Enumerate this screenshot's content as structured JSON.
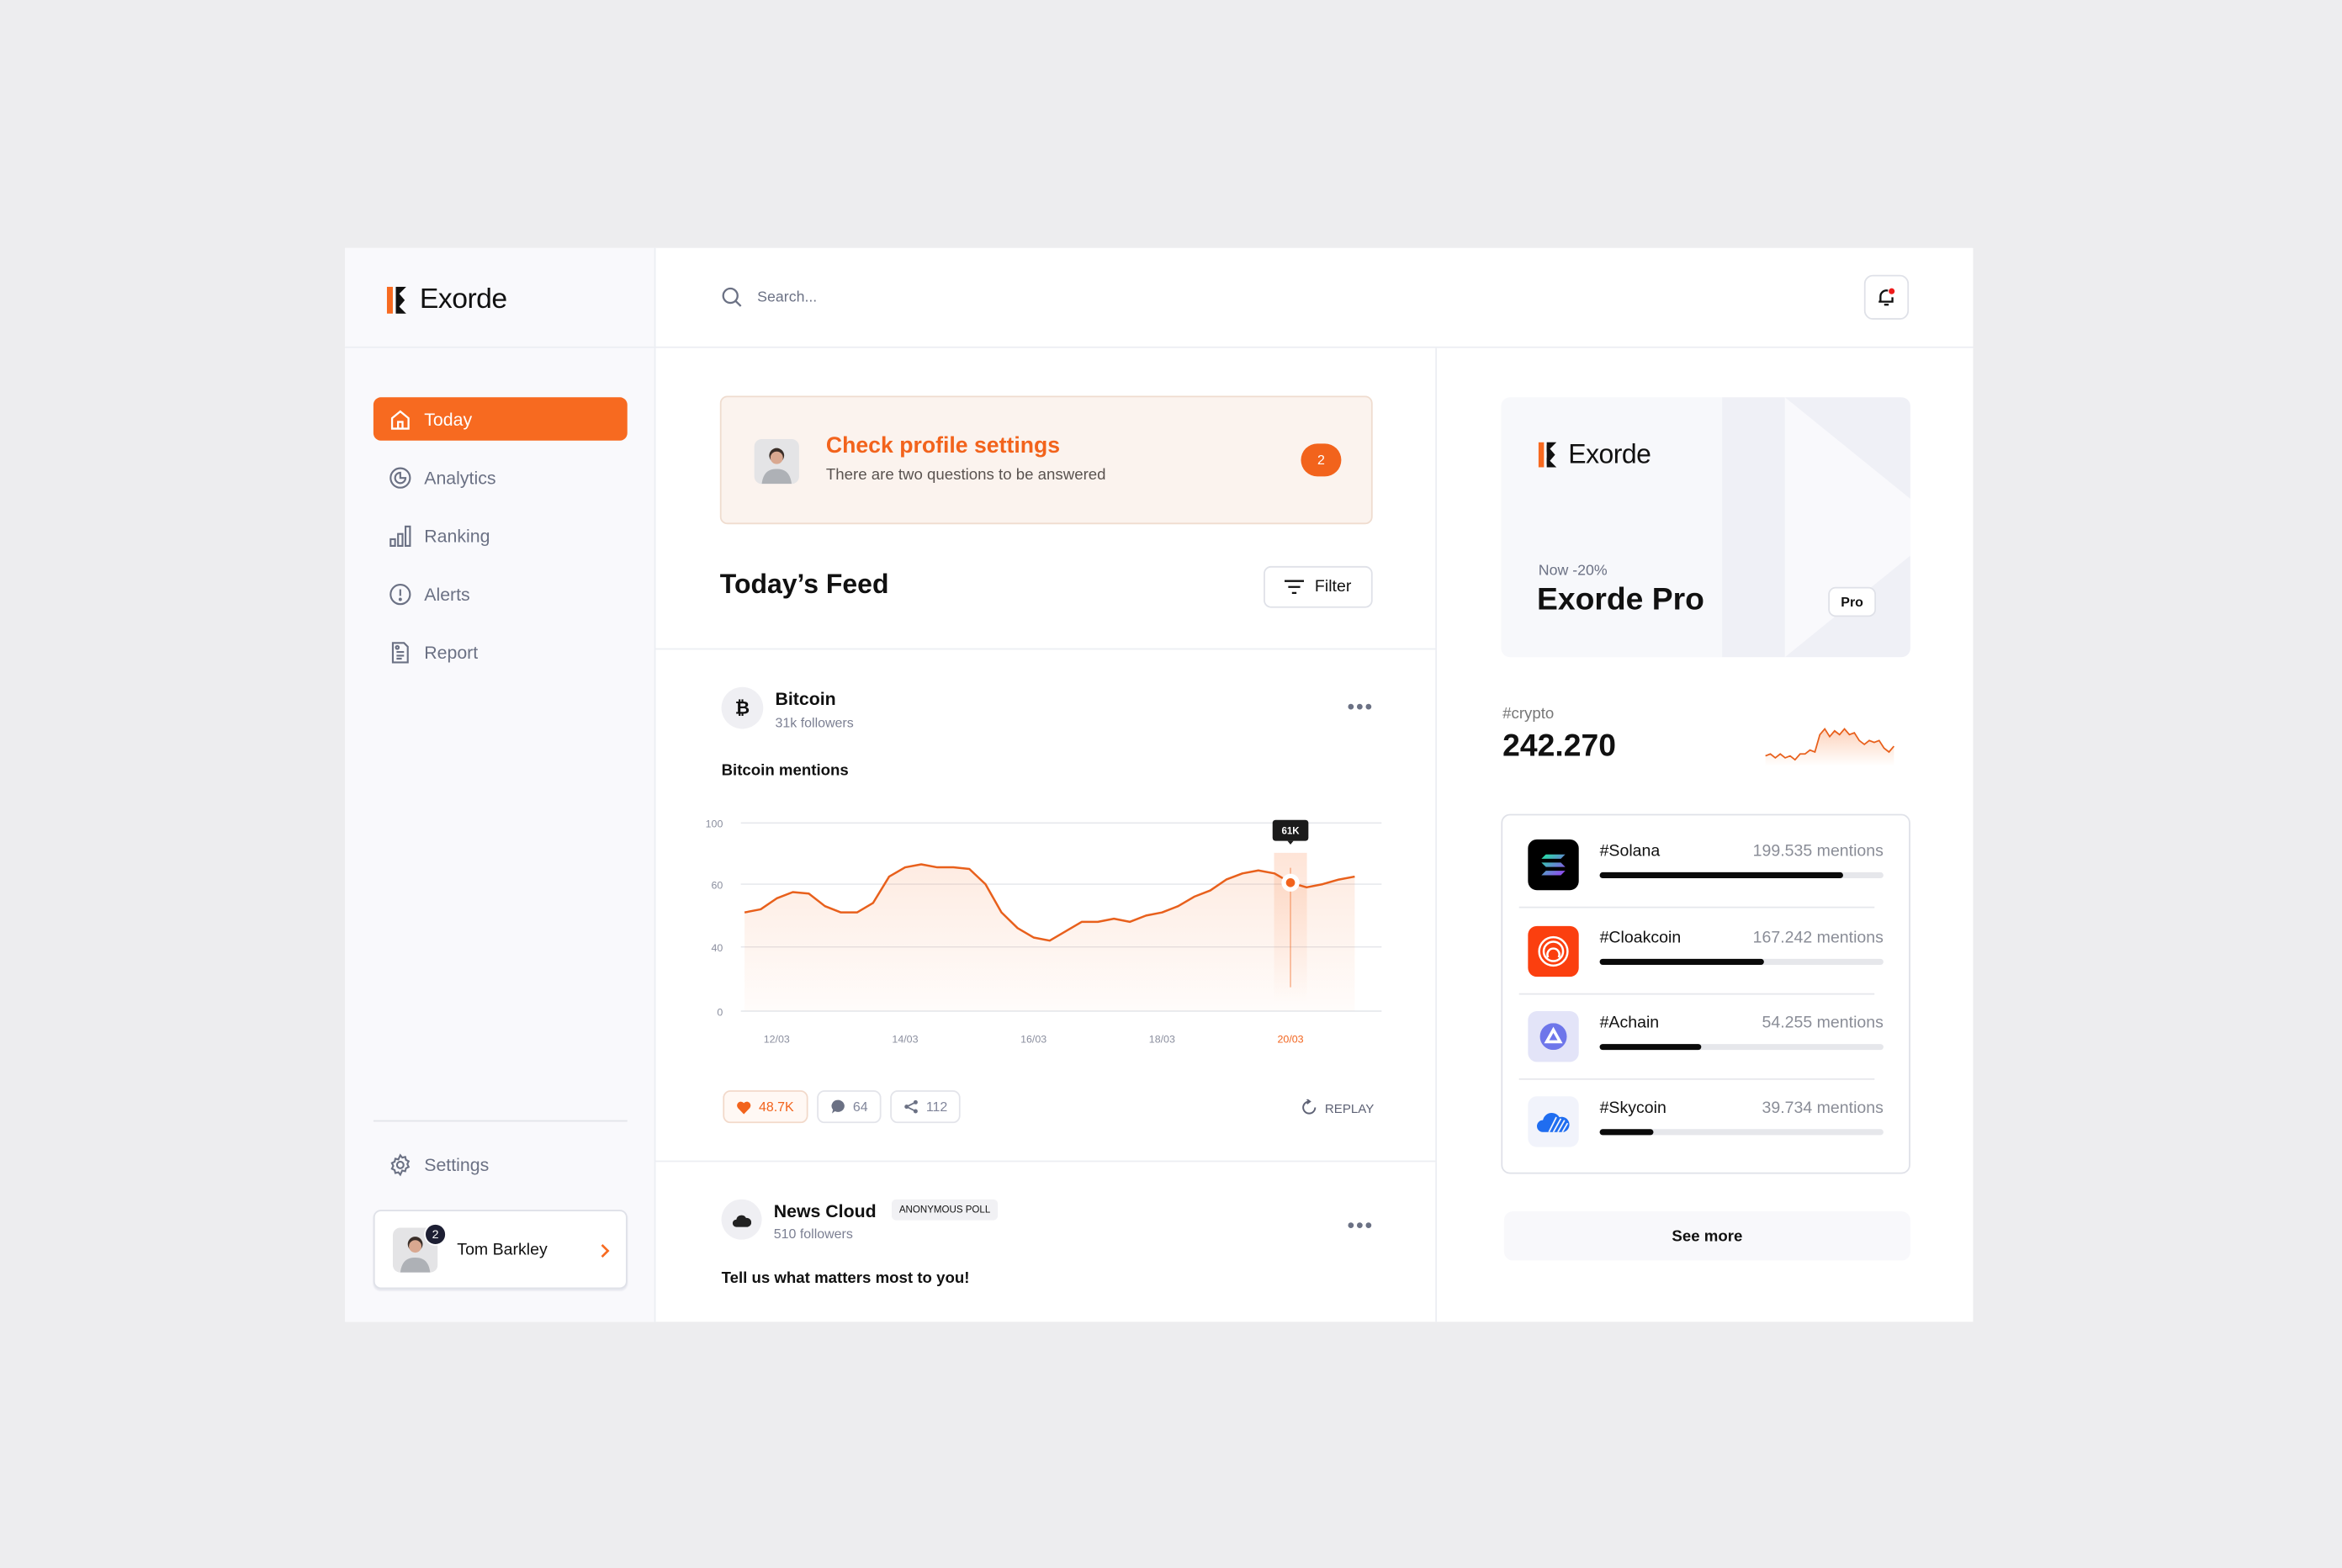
{
  "brand": {
    "name": "Exorde",
    "accent": "#f76a20"
  },
  "search": {
    "placeholder": "Search..."
  },
  "sidebar": {
    "items": [
      {
        "label": "Today",
        "icon": "home-icon",
        "active": true
      },
      {
        "label": "Analytics",
        "icon": "analytics-icon"
      },
      {
        "label": "Ranking",
        "icon": "bar-chart-icon"
      },
      {
        "label": "Alerts",
        "icon": "alert-icon"
      },
      {
        "label": "Report",
        "icon": "document-icon"
      }
    ],
    "settings": "Settings",
    "user": {
      "name": "Tom Barkley",
      "badge": "2"
    }
  },
  "alert": {
    "title": "Check profile settings",
    "subtitle": "There are two questions to be answered",
    "count": "2"
  },
  "feed": {
    "title": "Today’s Feed",
    "filter": "Filter",
    "posts": [
      {
        "name": "Bitcoin",
        "followers": "31k followers",
        "body": "Bitcoin mentions",
        "likes": "48.7K",
        "comments": "64",
        "shares": "112",
        "replay": "REPLAY"
      },
      {
        "name": "News Cloud",
        "badge": "ANONYMOUS POLL",
        "followers": "510 followers",
        "body": "Tell us what matters most to you!"
      }
    ]
  },
  "chart_data": {
    "type": "area",
    "ytick_labels": [
      "100",
      "60",
      "40",
      "0"
    ],
    "xtick_labels": [
      "12/03",
      "14/03",
      "16/03",
      "18/03",
      "20/03"
    ],
    "highlight": {
      "x": "20/03",
      "label": "61K"
    },
    "grid": true,
    "color": "#e8601c",
    "x": [
      "11/03 12:00",
      "11/03 18:00",
      "12/03 00:00",
      "12/03 06:00",
      "12/03 12:00",
      "12/03 18:00",
      "13/03 00:00",
      "13/03 06:00",
      "13/03 12:00",
      "13/03 18:00",
      "14/03 00:00",
      "14/03 06:00",
      "14/03 12:00",
      "14/03 18:00",
      "15/03 00:00",
      "15/03 06:00",
      "15/03 12:00",
      "15/03 18:00",
      "16/03 00:00",
      "16/03 06:00",
      "16/03 12:00",
      "16/03 18:00",
      "17/03 00:00",
      "17/03 06:00",
      "17/03 12:00",
      "17/03 18:00",
      "18/03 00:00",
      "18/03 06:00",
      "18/03 12:00",
      "18/03 18:00",
      "19/03 00:00",
      "19/03 06:00",
      "19/03 12:00",
      "19/03 18:00",
      "20/03 00:00",
      "20/03 06:00",
      "20/03 12:00",
      "20/03 18:00",
      "21/03 00:00"
    ],
    "y": [
      51,
      52,
      55.5,
      57.5,
      57,
      53,
      51,
      51,
      54,
      65,
      71,
      73,
      71,
      71,
      70,
      60,
      51,
      46,
      43,
      42,
      45,
      48,
      48,
      49,
      48,
      50,
      51,
      53,
      56,
      58,
      63,
      67,
      69,
      67,
      61,
      59,
      60,
      63,
      65
    ]
  },
  "promo": {
    "logo": "Exorde",
    "discount": "Now -20%",
    "title": "Exorde Pro",
    "badge": "Pro"
  },
  "crypto": {
    "tag": "#crypto",
    "value": "242.270",
    "sparkline": [
      3,
      4,
      2,
      4,
      2,
      3,
      1,
      4,
      4,
      6,
      5,
      14,
      17,
      13,
      16,
      14,
      17,
      14,
      15,
      11,
      9,
      11,
      10,
      11,
      7,
      5,
      8
    ]
  },
  "trending": [
    {
      "name": "#Solana",
      "mentions": "199.535 mentions",
      "share": 0.86,
      "icon": "solana-icon",
      "bg": "#000000"
    },
    {
      "name": "#Cloakcoin",
      "mentions": "167.242 mentions",
      "share": 0.58,
      "icon": "cloakcoin-icon",
      "bg": "#fb3f0f"
    },
    {
      "name": "#Achain",
      "mentions": "54.255 mentions",
      "share": 0.36,
      "icon": "achain-icon",
      "bg": "#e3e4f8"
    },
    {
      "name": "#Skycoin",
      "mentions": "39.734 mentions",
      "share": 0.19,
      "icon": "skycoin-icon",
      "bg": "#f1f3fb"
    }
  ],
  "see_more": "See more"
}
